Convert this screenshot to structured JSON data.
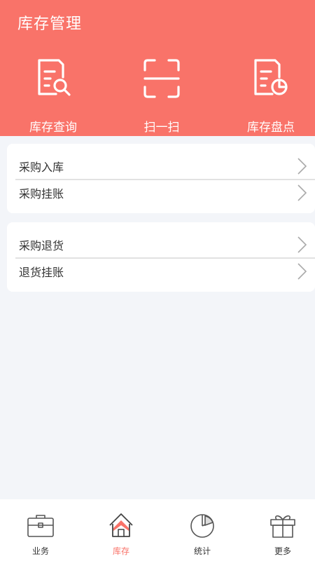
{
  "header": {
    "title": "库存管理"
  },
  "quick_actions": [
    {
      "label": "库存查询",
      "icon": "document-search-icon"
    },
    {
      "label": "扫一扫",
      "icon": "scan-icon"
    },
    {
      "label": "库存盘点",
      "icon": "document-chart-icon"
    }
  ],
  "groups": [
    {
      "items": [
        {
          "label": "采购入库"
        },
        {
          "label": "采购挂账"
        }
      ]
    },
    {
      "items": [
        {
          "label": "采购退货"
        },
        {
          "label": "退货挂账"
        }
      ]
    }
  ],
  "tabs": [
    {
      "label": "业务",
      "icon": "briefcase-icon",
      "active": false
    },
    {
      "label": "库存",
      "icon": "house-icon",
      "active": true
    },
    {
      "label": "统计",
      "icon": "pie-chart-icon",
      "active": false
    },
    {
      "label": "更多",
      "icon": "gift-icon",
      "active": false
    }
  ],
  "colors": {
    "accent": "#f97369",
    "background": "#f3f5f9",
    "text": "#333333"
  }
}
